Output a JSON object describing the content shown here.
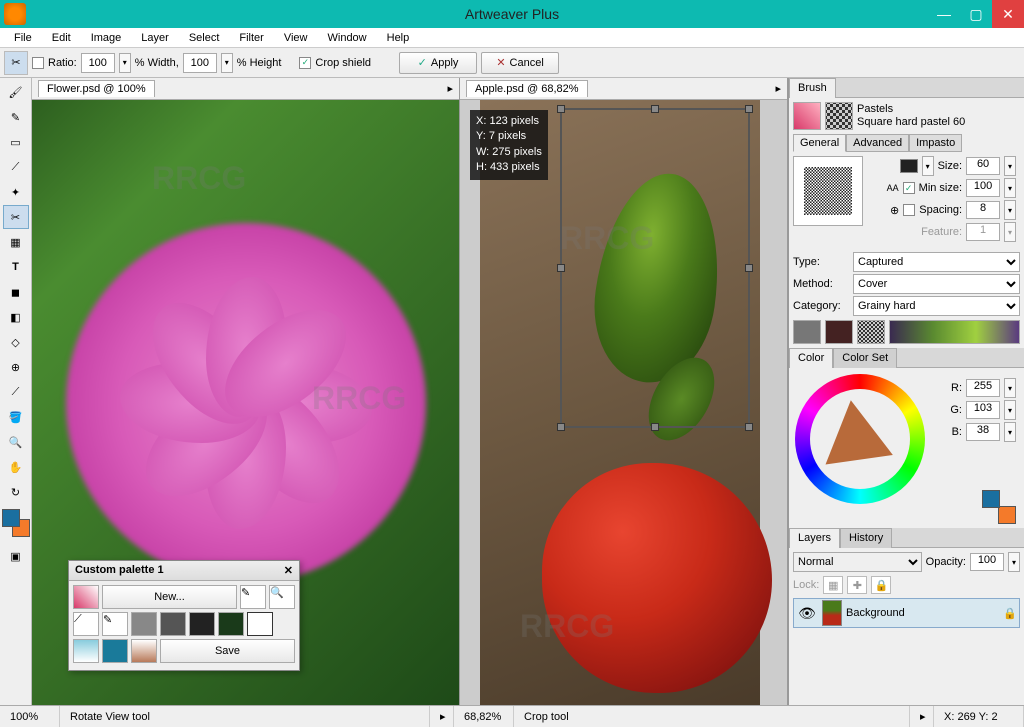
{
  "title": "Artweaver Plus",
  "menu": [
    "File",
    "Edit",
    "Image",
    "Layer",
    "Select",
    "Filter",
    "View",
    "Window",
    "Help"
  ],
  "options": {
    "ratio_label": "Ratio:",
    "w": "100",
    "w_label": "% Width,",
    "h": "100",
    "h_label": "% Height",
    "crop_shield": "Crop shield",
    "apply": "Apply",
    "cancel": "Cancel"
  },
  "docs": {
    "left": {
      "name": "Flower.psd @ 100%"
    },
    "right": {
      "name": "Apple.psd @ 68,82%"
    }
  },
  "crop": {
    "x": "X: 123 pixels",
    "y": "Y: 7 pixels",
    "w": "W: 275 pixels",
    "h": "H: 433 pixels"
  },
  "brush": {
    "tab": "Brush",
    "family": "Pastels",
    "variant": "Square hard pastel 60",
    "subtabs": [
      "General",
      "Advanced",
      "Impasto"
    ],
    "size_label": "Size:",
    "size": "60",
    "minsize_label": "Min size:",
    "minsize": "100",
    "spacing_label": "Spacing:",
    "spacing": "8",
    "feature_label": "Feature:",
    "feature": "1",
    "type_label": "Type:",
    "type": "Captured",
    "method_label": "Method:",
    "method": "Cover",
    "category_label": "Category:",
    "category": "Grainy hard"
  },
  "color": {
    "tab1": "Color",
    "tab2": "Color Set",
    "r_label": "R:",
    "r": "255",
    "g_label": "G:",
    "g": "103",
    "b_label": "B:",
    "b": "38"
  },
  "layers": {
    "tab1": "Layers",
    "tab2": "History",
    "blend": "Normal",
    "opacity_label": "Opacity:",
    "opacity": "100",
    "lock_label": "Lock:",
    "layer0": "Background"
  },
  "palette": {
    "title": "Custom palette 1",
    "new": "New...",
    "save": "Save"
  },
  "status": {
    "left_zoom": "100%",
    "left_tool": "Rotate View tool",
    "right_zoom": "68,82%",
    "right_tool": "Crop tool",
    "coords": "X: 269 Y: 2"
  },
  "watermark": "RRCG"
}
